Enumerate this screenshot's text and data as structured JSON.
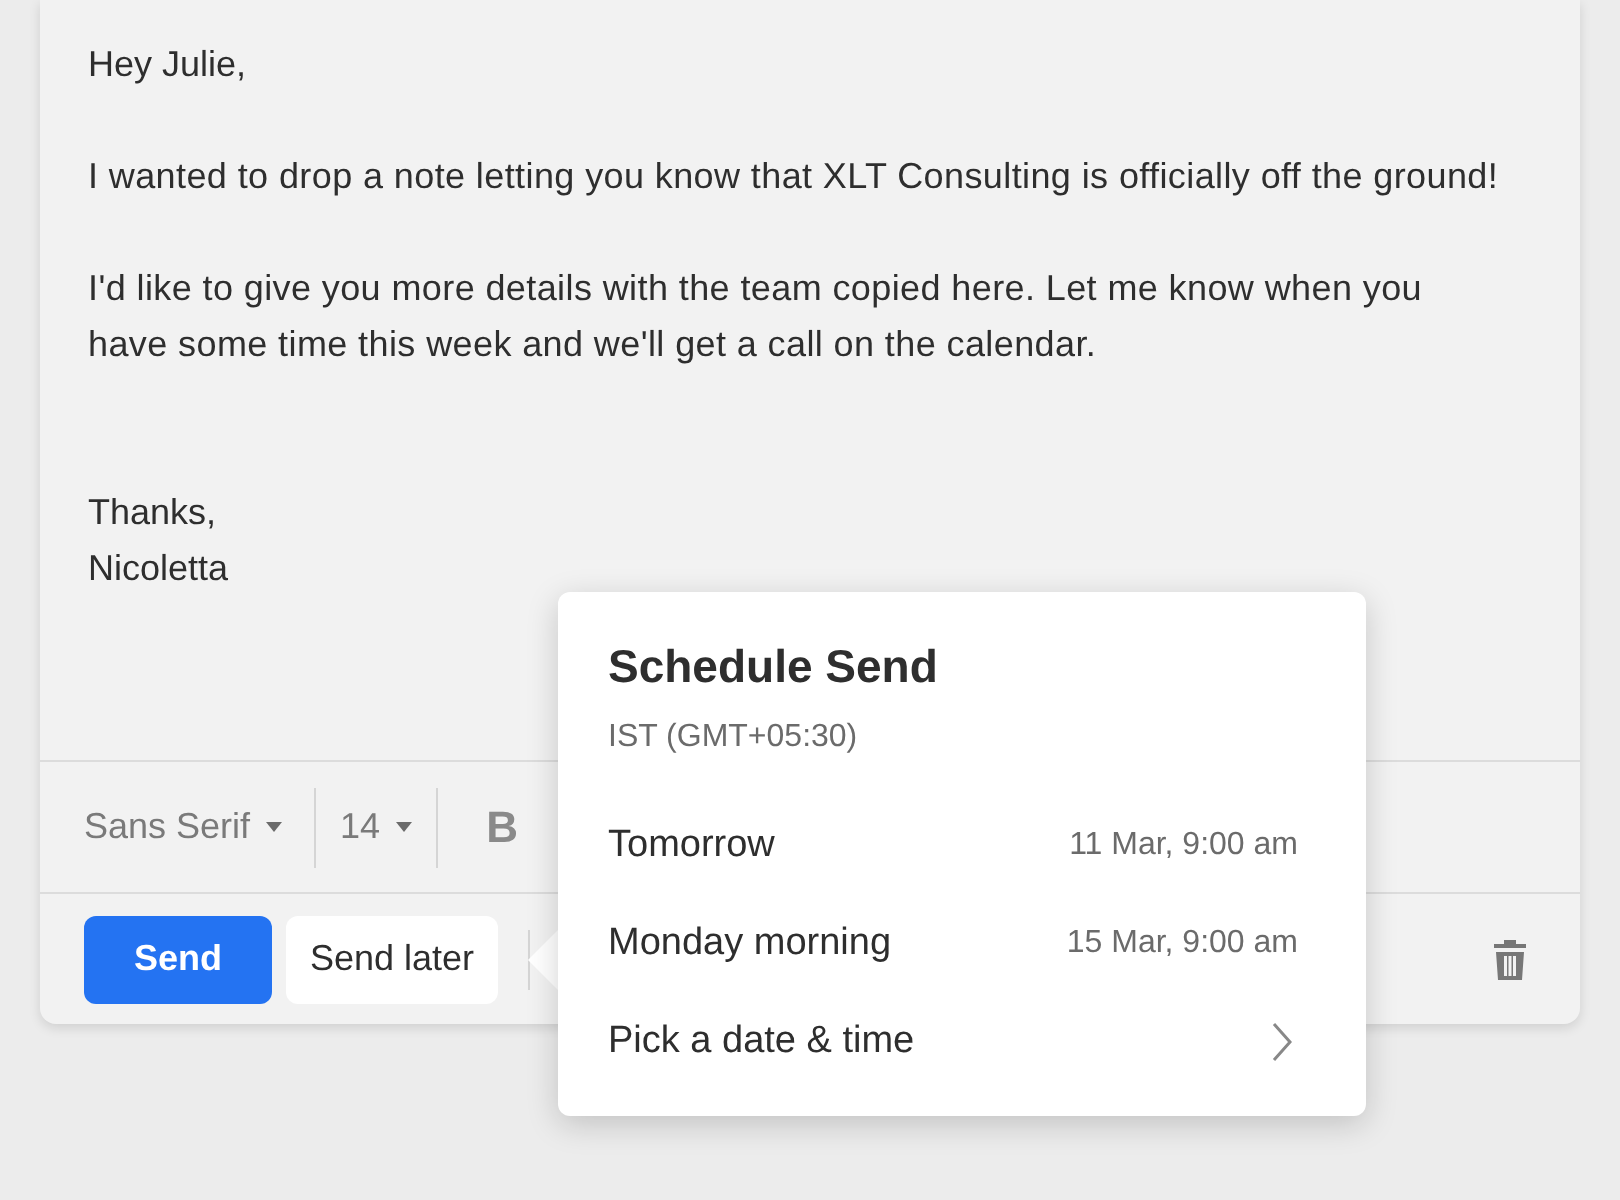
{
  "message": {
    "greeting": "Hey Julie,",
    "paragraphs": [
      "I wanted to drop a note letting you know that XLT Consulting is officially off the ground!",
      "I'd like to give you more details with the team copied here. Let me know when you have some time this week and we'll get a call on the calendar."
    ],
    "signoff": [
      "Thanks,",
      "Nicoletta"
    ]
  },
  "toolbar": {
    "font": "Sans Serif",
    "size": "14",
    "bold": "B"
  },
  "actions": {
    "send": "Send",
    "send_later": "Send later"
  },
  "schedule_popover": {
    "title": "Schedule Send",
    "timezone": "IST (GMT+05:30)",
    "options": [
      {
        "label": "Tomorrow",
        "time": "11 Mar, 9:00 am",
        "kind": "preset"
      },
      {
        "label": "Monday morning",
        "time": "15 Mar, 9:00 am",
        "kind": "preset"
      },
      {
        "label": "Pick a date & time",
        "kind": "custom"
      }
    ]
  }
}
